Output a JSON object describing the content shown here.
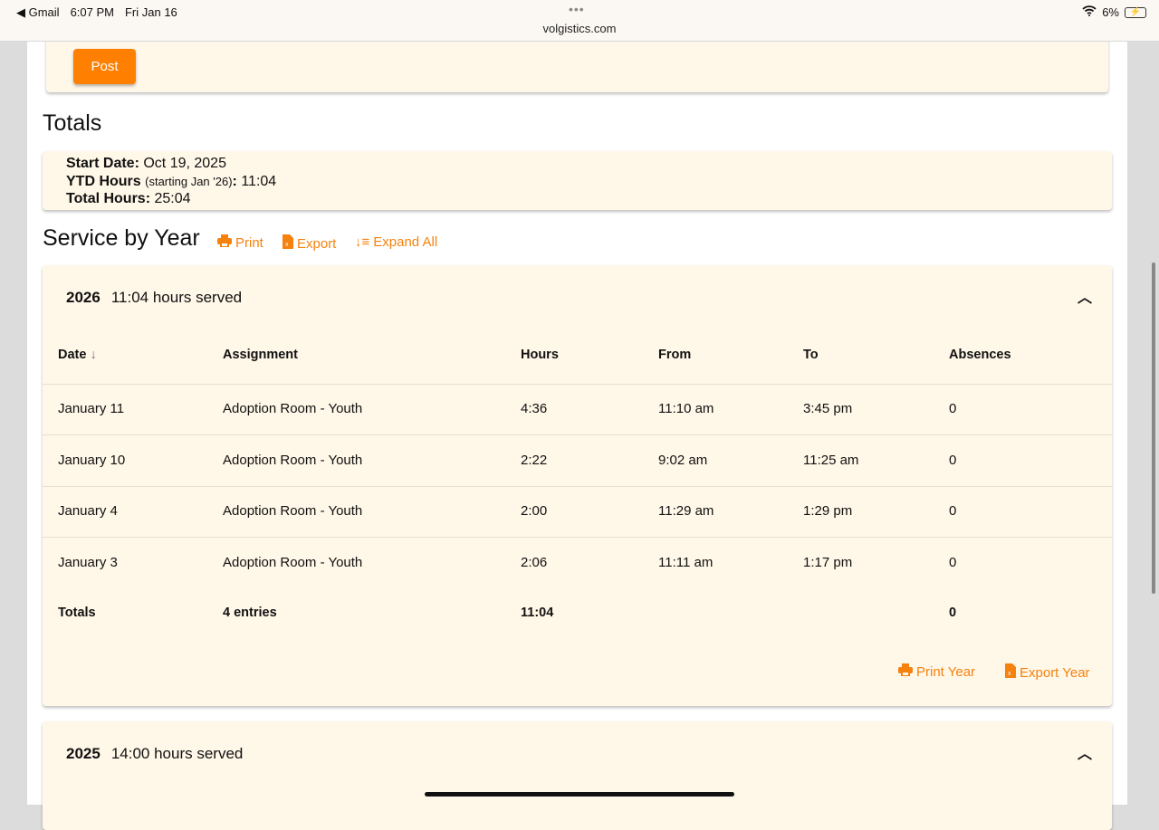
{
  "status_bar": {
    "back_app": "◀ Gmail",
    "time": "6:07 PM",
    "date": "Fri Jan 16",
    "url": "volgistics.com",
    "battery": "6%"
  },
  "post_button": "Post",
  "totals": {
    "heading": "Totals",
    "start_label": "Start Date:",
    "start_value": "Oct 19, 2025",
    "ytd_label": "YTD Hours",
    "ytd_note": "(starting Jan '26)",
    "ytd_value": "11:04",
    "total_label": "Total Hours:",
    "total_value": "25:04"
  },
  "service": {
    "heading": "Service by Year",
    "print": "Print",
    "export": "Export",
    "expand_all": "Expand All"
  },
  "year_2026": {
    "year": "2026",
    "summary": "11:04 hours served",
    "columns": [
      "Date",
      "Assignment",
      "Hours",
      "From",
      "To",
      "Absences"
    ],
    "rows": [
      [
        "January 11",
        "Adoption Room - Youth",
        "4:36",
        "11:10 am",
        "3:45 pm",
        "0"
      ],
      [
        "January 10",
        "Adoption Room - Youth",
        "2:22",
        "9:02 am",
        "11:25 am",
        "0"
      ],
      [
        "January 4",
        "Adoption Room - Youth",
        "2:00",
        "11:29 am",
        "1:29 pm",
        "0"
      ],
      [
        "January 3",
        "Adoption Room - Youth",
        "2:06",
        "11:11 am",
        "1:17 pm",
        "0"
      ]
    ],
    "totals": {
      "label": "Totals",
      "entries": "4 entries",
      "hours": "11:04",
      "absences": "0"
    },
    "print_year": "Print Year",
    "export_year": "Export Year"
  },
  "year_2025": {
    "year": "2025",
    "summary": "14:00 hours served"
  },
  "accent": "#ff8000"
}
